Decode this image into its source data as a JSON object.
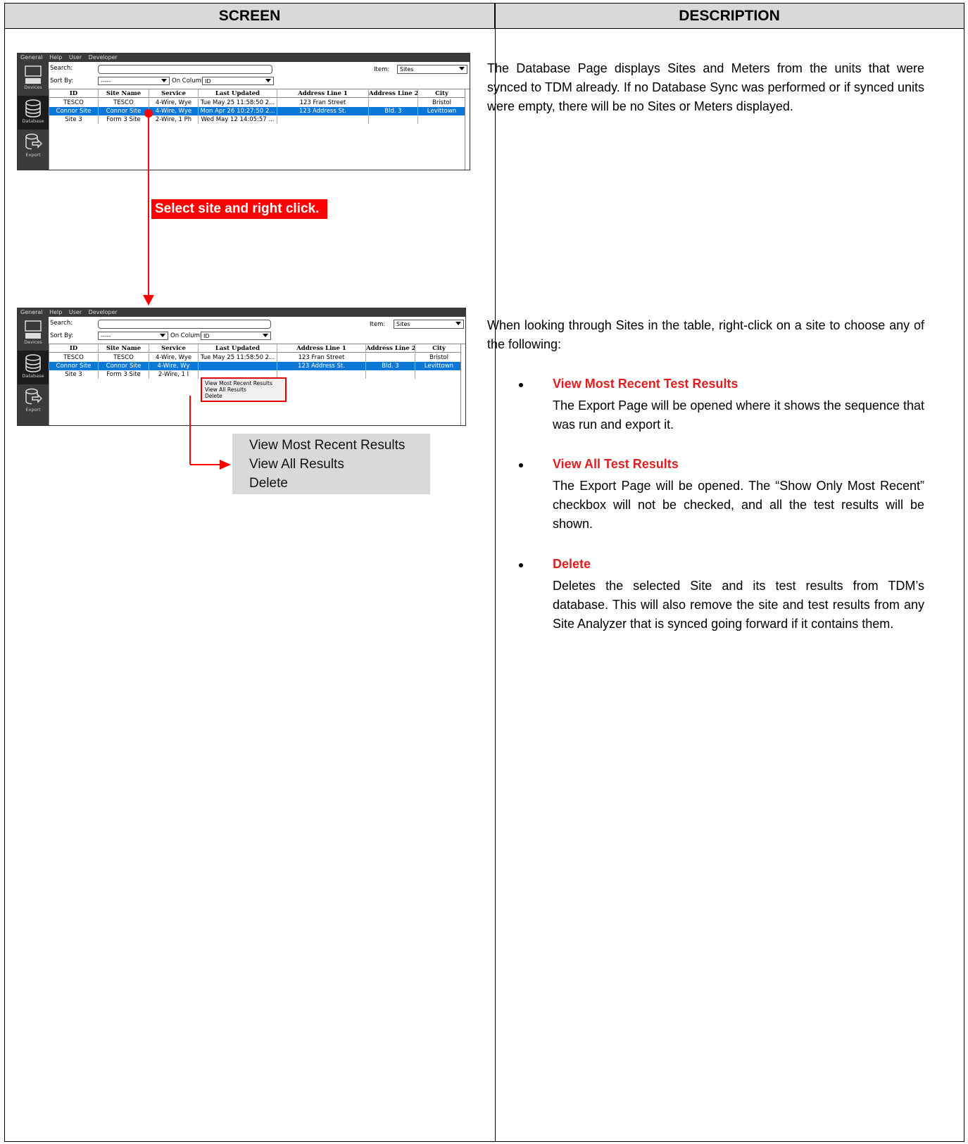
{
  "header": {
    "screen_label": "SCREEN",
    "description_label": "DESCRIPTION"
  },
  "app": {
    "menu": [
      "General",
      "Help",
      "User",
      "Developer"
    ],
    "sidebar": [
      "Devices",
      "Database",
      "Export"
    ],
    "search_label": "Search:",
    "sort_label": "Sort By:",
    "sort_value": "-----",
    "on_column_label": "On Column:",
    "on_column_value": "ID",
    "item_label": "Item:",
    "item_value": "Sites",
    "columns": [
      "ID",
      "Site Name",
      "Service",
      "Last Updated",
      "Address Line 1",
      "Address Line 2",
      "City"
    ],
    "rows": [
      [
        "TESCO",
        "TESCO",
        "4-Wire, Wye",
        "Tue May 25 11:58:50 2...",
        "123 Fran Street",
        "",
        "Bristol"
      ],
      [
        "Connor Site",
        "Connor Site",
        "4-Wire, Wye",
        "Mon Apr 26 10:27:50 2...",
        "123 Address St.",
        "Bld. 3",
        "Levittown"
      ],
      [
        "Site 3",
        "Form 3 Site",
        "2-Wire, 1 Ph",
        "Wed May 12 14:05:57 ...",
        "",
        "",
        ""
      ]
    ],
    "rows_second": [
      [
        "TESCO",
        "TESCO",
        "4-Wire, Wye",
        "Tue May 25 11:58:50 2...",
        "123 Fran Street",
        "",
        "Bristol"
      ],
      [
        "Connor Site",
        "Connor Site",
        "4-Wire, Wy",
        "",
        "123 Address St.",
        "Bld. 3",
        "Levittown"
      ],
      [
        "Site 3",
        "Form 3 Site",
        "2-Wire, 1 I",
        "",
        "",
        "",
        ""
      ]
    ],
    "context_menu": [
      "View Most Recent Results",
      "View All Results",
      "Delete"
    ]
  },
  "callout": "Select site and right click.",
  "enlarged_menu": [
    "View Most Recent Results",
    "View All Results",
    "Delete"
  ],
  "desc": {
    "para1": "The Database Page displays Sites and Meters from the units that were synced to TDM already. If no Database Sync was performed or if synced units were empty, there will be no Sites or Meters displayed.",
    "para2": "When looking through Sites in the table, right-click on a site to choose any of the following:",
    "bullets": [
      {
        "title": "View Most Recent Test Results",
        "body": "The Export Page will be opened where it shows the sequence that was run and export it."
      },
      {
        "title": "View All Test Results",
        "body": "The Export Page will be opened. The “Show Only Most Recent” checkbox will not be checked, and all the test results will be shown."
      },
      {
        "title": "Delete",
        "body": "Deletes the selected Site and its test results from TDM’s database. This will also remove the site and test results from any Site Analyzer that is synced going forward if it contains them."
      }
    ]
  },
  "colors": {
    "accent_red": "#ff0000",
    "selection_blue": "#0b78d7",
    "header_gray": "#d9d9d9"
  }
}
